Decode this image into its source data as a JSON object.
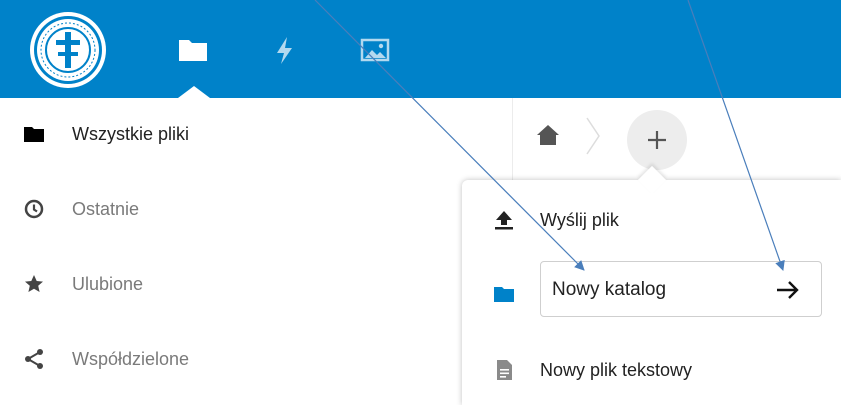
{
  "colors": {
    "header_bg": "#0082c9",
    "folder_blue": "#0082c9",
    "arrow_annotation": "#4a7ebb"
  },
  "header": {
    "logo_icon": "university-seal-logo",
    "apps": [
      {
        "name": "files",
        "icon": "folder-icon",
        "active": true
      },
      {
        "name": "activity",
        "icon": "lightning-icon",
        "active": false
      },
      {
        "name": "gallery",
        "icon": "image-icon",
        "active": false
      }
    ]
  },
  "sidebar": {
    "items": [
      {
        "label": "Wszystkie pliki",
        "icon": "folder-icon",
        "active": true
      },
      {
        "label": "Ostatnie",
        "icon": "clock-icon",
        "active": false
      },
      {
        "label": "Ulubione",
        "icon": "star-icon",
        "active": false
      },
      {
        "label": "Współdzielone",
        "icon": "share-icon",
        "active": false
      }
    ]
  },
  "breadcrumb": {
    "home_icon": "home-icon",
    "new_button_icon": "plus-icon"
  },
  "new_menu": {
    "items": [
      {
        "label": "Wyślij plik",
        "icon": "upload-icon"
      },
      {
        "label": "Nowy katalog",
        "icon": "folder-icon",
        "editing": true
      },
      {
        "label": "Nowy plik tekstowy",
        "icon": "text-file-icon"
      }
    ],
    "folder_input_value": "Nowy katalog",
    "submit_icon": "arrow-right-icon"
  }
}
